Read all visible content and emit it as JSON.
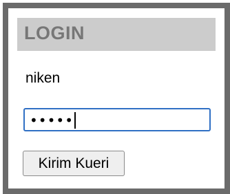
{
  "form": {
    "title": "LOGIN",
    "username_value": "niken",
    "password_masked": "•••••",
    "submit_label": "Kirim Kueri"
  },
  "colors": {
    "frame_border": "#6b6b6b",
    "header_bg": "#cccccc",
    "header_text": "#777777",
    "focus_border": "#2f6fc4",
    "button_bg": "#efefef"
  }
}
